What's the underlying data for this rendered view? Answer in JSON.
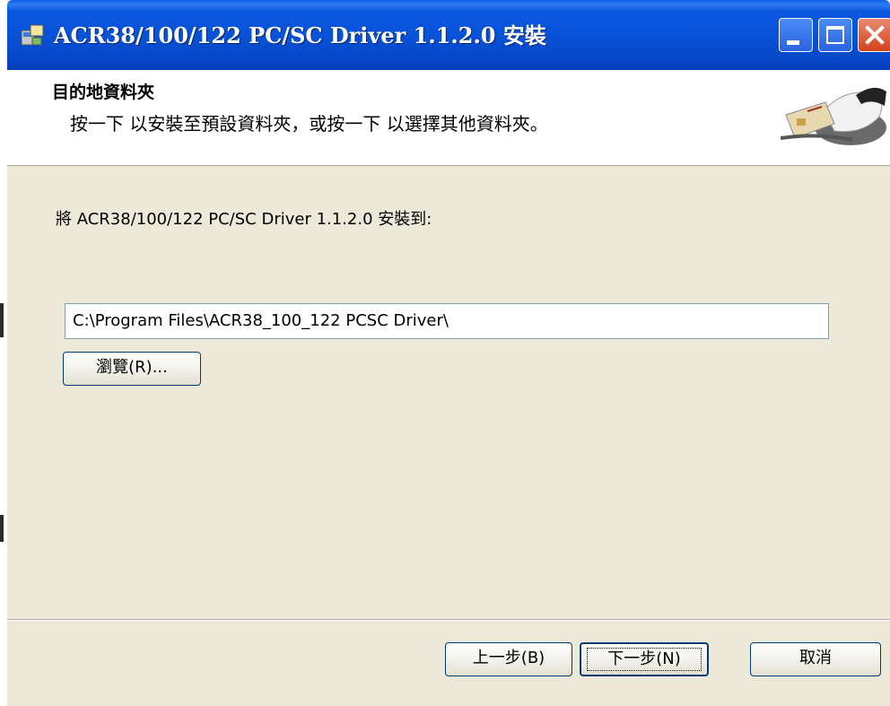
{
  "window": {
    "title": "ACR38/100/122 PC/SC Driver 1.1.2.0 安裝",
    "icon": "installer-icon",
    "controls": [
      "minimize-icon",
      "maximize-icon",
      "close-icon"
    ]
  },
  "banner": {
    "title": "目的地資料夾",
    "description": "按一下 以安裝至預設資料夾，或按一下 以選擇其他資料夾。",
    "image": "smart-card-reader-image"
  },
  "body": {
    "install_to_label": "將 ACR38/100/122 PC/SC Driver 1.1.2.0 安裝到:",
    "path_value": "C:\\Program Files\\ACR38_100_122 PCSC Driver\\",
    "browse_label": "瀏覽(R)..."
  },
  "footer": {
    "back_label": "上一步(B)",
    "next_label": "下一步(N)",
    "cancel_label": "取消"
  },
  "colors": {
    "titlebar": "#0852d8",
    "dialog_bg": "#ece9d8",
    "banner_bg": "#ffffff",
    "close_btn": "#d4421c"
  }
}
